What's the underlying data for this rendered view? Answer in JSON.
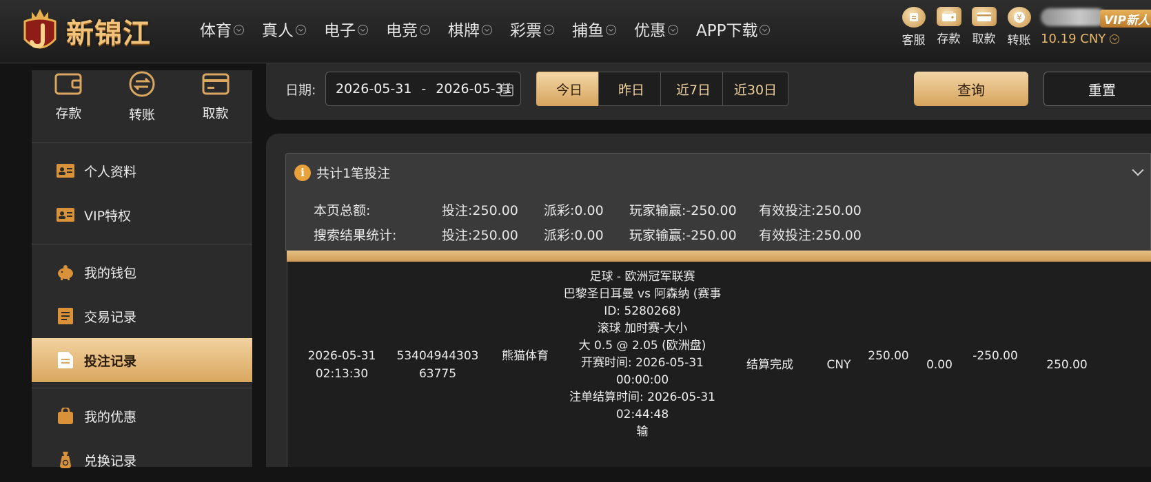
{
  "brand": {
    "name": "新锦江"
  },
  "nav": [
    {
      "label": "体育"
    },
    {
      "label": "真人"
    },
    {
      "label": "电子"
    },
    {
      "label": "电竞"
    },
    {
      "label": "棋牌"
    },
    {
      "label": "彩票"
    },
    {
      "label": "捕鱼"
    },
    {
      "label": "优惠"
    },
    {
      "label": "APP下载"
    }
  ],
  "header_tools": [
    {
      "label": "客服",
      "icon": "customer-service-icon"
    },
    {
      "label": "存款",
      "icon": "wallet-icon"
    },
    {
      "label": "取款",
      "icon": "withdraw-card-icon"
    },
    {
      "label": "转账",
      "icon": "transfer-coin-icon"
    }
  ],
  "account": {
    "vip_label": "VIP新人",
    "balance": "10.19 CNY"
  },
  "sidebar": {
    "quick": [
      {
        "label": "存款",
        "icon": "wallet-icon"
      },
      {
        "label": "转账",
        "icon": "transfer-icon"
      },
      {
        "label": "取款",
        "icon": "card-icon"
      }
    ],
    "groups": [
      {
        "items": [
          {
            "label": "个人资料",
            "icon": "profile-card-icon"
          },
          {
            "label": "VIP特权",
            "icon": "vip-card-icon"
          }
        ]
      },
      {
        "items": [
          {
            "label": "我的钱包",
            "icon": "piggy-bank-icon"
          },
          {
            "label": "交易记录",
            "icon": "receipt-icon"
          },
          {
            "label": "投注记录",
            "icon": "bet-document-icon",
            "active": true
          }
        ]
      },
      {
        "items": [
          {
            "label": "我的优惠",
            "icon": "gift-bag-icon"
          },
          {
            "label": "兑换记录",
            "icon": "money-bag-icon"
          }
        ]
      }
    ]
  },
  "filter": {
    "date_label": "日期:",
    "date_from": "2026-05-31",
    "date_sep": "-",
    "date_to": "2026-05-31",
    "ranges": [
      {
        "label": "今日",
        "active": true
      },
      {
        "label": "昨日"
      },
      {
        "label": "近7日"
      },
      {
        "label": "近30日"
      }
    ],
    "query_label": "查询",
    "reset_label": "重置"
  },
  "summary": {
    "title": "共计1笔投注",
    "rows": [
      {
        "label": "本页总额:",
        "bet": "投注:250.00",
        "payout": "派彩:0.00",
        "winloss": "玩家输赢:-250.00",
        "valid": "有效投注:250.00"
      },
      {
        "label": "搜索结果统计:",
        "bet": "投注:250.00",
        "payout": "派彩:0.00",
        "winloss": "玩家输赢:-250.00",
        "valid": "有效投注:250.00"
      }
    ]
  },
  "bet_record": {
    "time": "2026-05-31 02:13:30",
    "bet_id": "5340494430363775",
    "venue": "熊猫体育",
    "detail_lines": [
      "足球 - 欧洲冠军联赛",
      "巴黎圣日耳曼 vs 阿森纳 (赛事ID: 5280268)",
      "滚球 加时赛-大小",
      "大 0.5 @ 2.05 (欧洲盘)",
      "开赛时间: 2026-05-31 00:00:00",
      "注单结算时间: 2026-05-31 02:44:48",
      "输"
    ],
    "status": "结算完成",
    "currency": "CNY",
    "bet_amount": "250.00",
    "payout": "0.00",
    "win_loss": "-250.00",
    "valid_bet": "250.00"
  },
  "colors": {
    "accent_gold": "#d9a75f",
    "panel": "#2b2b2b",
    "bg": "#141414"
  }
}
